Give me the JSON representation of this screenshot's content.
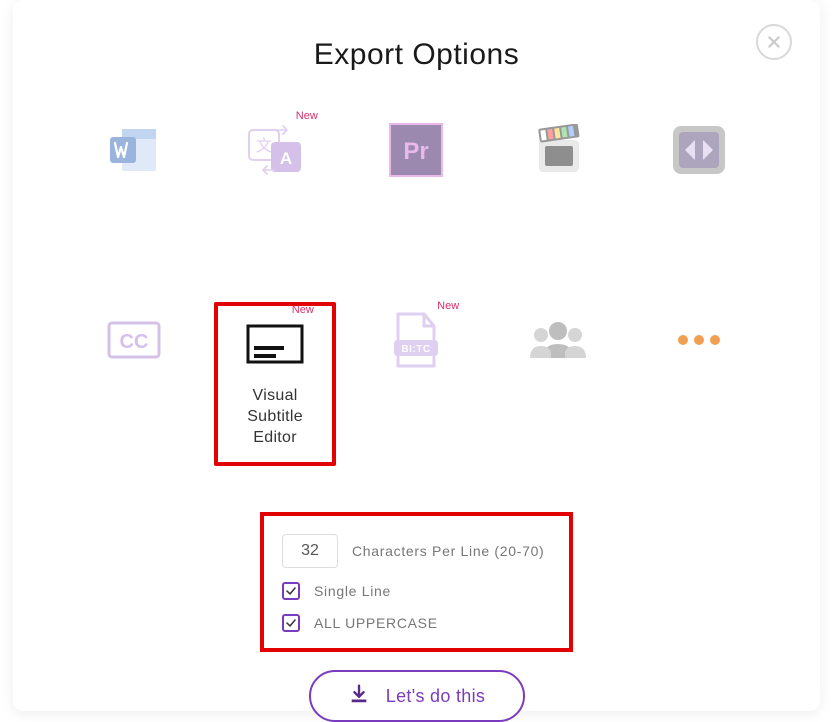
{
  "title": "Export Options",
  "new_badge": "New",
  "tiles": {
    "visual_subtitle_editor": "Visual Subtitle\nEditor"
  },
  "options": {
    "chars_per_line_value": "32",
    "chars_per_line_label": "Characters Per Line (20-70)",
    "single_line_label": "Single Line",
    "uppercase_label": "ALL UPPERCASE"
  },
  "cta_label": "Let's do this"
}
